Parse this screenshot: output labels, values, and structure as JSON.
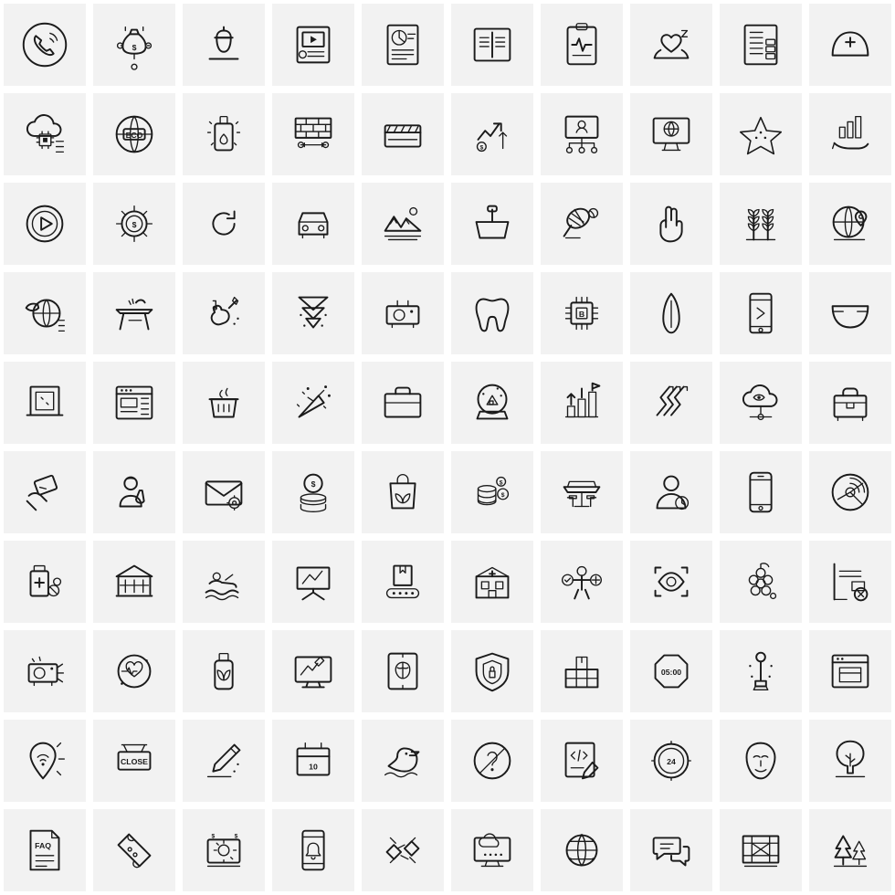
{
  "sheet": {
    "title": "Line Icon Sheet",
    "columns": 10,
    "rows": 10,
    "background_color": "#ffffff",
    "tile_color": "#f2f2f2",
    "stroke_color": "#1b1b1b"
  },
  "icons": [
    {
      "row": 1,
      "col": 1,
      "name": "call-phone-circle-icon",
      "label": "Phone Call"
    },
    {
      "row": 1,
      "col": 2,
      "name": "money-bag-connection-icon",
      "label": "Money Bag Network"
    },
    {
      "row": 1,
      "col": 3,
      "name": "acorn-nut-icon",
      "label": "Acorn"
    },
    {
      "row": 1,
      "col": 4,
      "name": "video-document-icon",
      "label": "Video Document"
    },
    {
      "row": 1,
      "col": 5,
      "name": "report-pie-chart-icon",
      "label": "Pie Chart Report"
    },
    {
      "row": 1,
      "col": 6,
      "name": "open-book-icon",
      "label": "Open Book"
    },
    {
      "row": 1,
      "col": 7,
      "name": "medical-clipboard-pulse-icon",
      "label": "Medical Report"
    },
    {
      "row": 1,
      "col": 8,
      "name": "heart-hands-icon",
      "label": "Heart in Hands"
    },
    {
      "row": 1,
      "col": 9,
      "name": "server-document-icon",
      "label": "Server Document"
    },
    {
      "row": 1,
      "col": 10,
      "name": "nurse-cap-icon",
      "label": "Nurse Cap"
    },
    {
      "row": 2,
      "col": 1,
      "name": "cloud-chip-icon",
      "label": "Cloud Computing Chip"
    },
    {
      "row": 2,
      "col": 2,
      "name": "eco-globe-icon",
      "label": "Eco Globe",
      "text": "ECO"
    },
    {
      "row": 2,
      "col": 3,
      "name": "perfume-bottle-icon",
      "label": "Perfume Bottle"
    },
    {
      "row": 2,
      "col": 4,
      "name": "brick-wall-icon",
      "label": "Brick Wall"
    },
    {
      "row": 2,
      "col": 5,
      "name": "clapperboard-icon",
      "label": "Clapperboard"
    },
    {
      "row": 2,
      "col": 6,
      "name": "growth-arrows-dollar-icon",
      "label": "Financial Growth"
    },
    {
      "row": 2,
      "col": 7,
      "name": "org-chart-user-icon",
      "label": "Organization Chart"
    },
    {
      "row": 2,
      "col": 8,
      "name": "global-network-monitor-icon",
      "label": "Global Network Monitor"
    },
    {
      "row": 2,
      "col": 9,
      "name": "starfish-icon",
      "label": "Starfish"
    },
    {
      "row": 2,
      "col": 10,
      "name": "bar-chart-hand-icon",
      "label": "Growth in Hand"
    },
    {
      "row": 3,
      "col": 1,
      "name": "play-button-circle-icon",
      "label": "Play Button"
    },
    {
      "row": 3,
      "col": 2,
      "name": "dollar-coin-target-icon",
      "label": "Dollar Coin"
    },
    {
      "row": 3,
      "col": 3,
      "name": "refresh-arrow-icon",
      "label": "Refresh"
    },
    {
      "row": 3,
      "col": 4,
      "name": "car-front-icon",
      "label": "Car"
    },
    {
      "row": 3,
      "col": 5,
      "name": "mountain-landscape-icon",
      "label": "Mountain Landscape"
    },
    {
      "row": 3,
      "col": 6,
      "name": "shopping-basket-icon",
      "label": "Shopping Basket"
    },
    {
      "row": 3,
      "col": 7,
      "name": "tennis-racket-ball-icon",
      "label": "Tennis Racket"
    },
    {
      "row": 3,
      "col": 8,
      "name": "victory-hand-icon",
      "label": "Victory Hand"
    },
    {
      "row": 3,
      "col": 9,
      "name": "wheat-plants-icon",
      "label": "Wheat Plants"
    },
    {
      "row": 3,
      "col": 10,
      "name": "global-location-pin-icon",
      "label": "Global Location"
    },
    {
      "row": 4,
      "col": 1,
      "name": "eco-globe-leaf-icon",
      "label": "Green Globe"
    },
    {
      "row": 4,
      "col": 2,
      "name": "ironing-board-icon",
      "label": "Ironing Board"
    },
    {
      "row": 4,
      "col": 3,
      "name": "violin-music-icon",
      "label": "Violin Music"
    },
    {
      "row": 4,
      "col": 4,
      "name": "down-arrows-icon",
      "label": "Download Arrows"
    },
    {
      "row": 4,
      "col": 5,
      "name": "projector-icon",
      "label": "Projector"
    },
    {
      "row": 4,
      "col": 6,
      "name": "tooth-icon",
      "label": "Tooth"
    },
    {
      "row": 4,
      "col": 7,
      "name": "processor-chip-icon",
      "label": "Processor Chip",
      "text": "B"
    },
    {
      "row": 4,
      "col": 8,
      "name": "surfboard-icon",
      "label": "Surfboard"
    },
    {
      "row": 4,
      "col": 9,
      "name": "smartphone-icon",
      "label": "Smartphone"
    },
    {
      "row": 4,
      "col": 10,
      "name": "diaper-icon",
      "label": "Diaper"
    },
    {
      "row": 5,
      "col": 1,
      "name": "window-frame-icon",
      "label": "Window"
    },
    {
      "row": 5,
      "col": 2,
      "name": "web-layout-icon",
      "label": "Web Layout"
    },
    {
      "row": 5,
      "col": 3,
      "name": "garbage-bin-icon",
      "label": "Trash Bin"
    },
    {
      "row": 5,
      "col": 4,
      "name": "party-popper-icon",
      "label": "Party Popper"
    },
    {
      "row": 5,
      "col": 5,
      "name": "briefcase-icon",
      "label": "Briefcase"
    },
    {
      "row": 5,
      "col": 6,
      "name": "snow-globe-icon",
      "label": "Snow Globe"
    },
    {
      "row": 5,
      "col": 7,
      "name": "growth-stairs-flag-icon",
      "label": "Growth Stairs"
    },
    {
      "row": 5,
      "col": 8,
      "name": "zigzag-arrows-icon",
      "label": "Zigzag Arrows"
    },
    {
      "row": 5,
      "col": 9,
      "name": "cloud-eye-monitoring-icon",
      "label": "Cloud Monitoring"
    },
    {
      "row": 5,
      "col": 10,
      "name": "business-bag-icon",
      "label": "Business Bag"
    },
    {
      "row": 6,
      "col": 1,
      "name": "hand-card-icon",
      "label": "Hand with Card"
    },
    {
      "row": 6,
      "col": 2,
      "name": "scientist-flask-icon",
      "label": "Scientist"
    },
    {
      "row": 6,
      "col": 3,
      "name": "email-settings-icon",
      "label": "Email Settings"
    },
    {
      "row": 6,
      "col": 4,
      "name": "dollar-coins-stack-icon",
      "label": "Coin Stack"
    },
    {
      "row": 6,
      "col": 5,
      "name": "eco-bag-icon",
      "label": "Eco Bag"
    },
    {
      "row": 6,
      "col": 6,
      "name": "money-coins-icon",
      "label": "Money Coins"
    },
    {
      "row": 6,
      "col": 7,
      "name": "outdoor-cafe-icon",
      "label": "Outdoor Cafe"
    },
    {
      "row": 6,
      "col": 8,
      "name": "user-time-icon",
      "label": "User Time"
    },
    {
      "row": 6,
      "col": 9,
      "name": "mobile-phone-icon",
      "label": "Mobile Phone"
    },
    {
      "row": 6,
      "col": 10,
      "name": "analytics-donut-icon",
      "label": "Analytics Donut"
    },
    {
      "row": 7,
      "col": 1,
      "name": "medicine-bottle-pills-icon",
      "label": "Medicine"
    },
    {
      "row": 7,
      "col": 2,
      "name": "bank-building-icon",
      "label": "Bank Building"
    },
    {
      "row": 7,
      "col": 3,
      "name": "swimmer-icon",
      "label": "Swimmer"
    },
    {
      "row": 7,
      "col": 4,
      "name": "presentation-board-icon",
      "label": "Presentation Board"
    },
    {
      "row": 7,
      "col": 5,
      "name": "conveyor-parcel-icon",
      "label": "Conveyor Parcel"
    },
    {
      "row": 7,
      "col": 6,
      "name": "hospital-building-icon",
      "label": "Hospital"
    },
    {
      "row": 7,
      "col": 7,
      "name": "person-choice-icon",
      "label": "Decision Making"
    },
    {
      "row": 7,
      "col": 8,
      "name": "eye-scan-icon",
      "label": "Eye Scan"
    },
    {
      "row": 7,
      "col": 9,
      "name": "grapes-icon",
      "label": "Grapes"
    },
    {
      "row": 7,
      "col": 10,
      "name": "remove-file-icon",
      "label": "Delete Item"
    },
    {
      "row": 8,
      "col": 1,
      "name": "camera-projector-icon",
      "label": "Camera Projector"
    },
    {
      "row": 8,
      "col": 2,
      "name": "heart-care-circle-icon",
      "label": "Heart Care"
    },
    {
      "row": 8,
      "col": 3,
      "name": "eco-bottle-icon",
      "label": "Eco Bottle"
    },
    {
      "row": 8,
      "col": 4,
      "name": "design-monitor-icon",
      "label": "Design Monitor"
    },
    {
      "row": 8,
      "col": 5,
      "name": "brain-scan-icon",
      "label": "Brain Scan"
    },
    {
      "row": 8,
      "col": 6,
      "name": "security-shield-icon",
      "label": "Security Shield"
    },
    {
      "row": 8,
      "col": 7,
      "name": "warehouse-boxes-icon",
      "label": "Warehouse Boxes"
    },
    {
      "row": 8,
      "col": 8,
      "name": "stop-timer-icon",
      "label": "Stop Timer",
      "text": "05:00"
    },
    {
      "row": 8,
      "col": 9,
      "name": "street-lamp-icon",
      "label": "Street Lamp"
    },
    {
      "row": 8,
      "col": 10,
      "name": "browser-window-icon",
      "label": "Browser Window"
    },
    {
      "row": 9,
      "col": 1,
      "name": "wifi-location-pin-icon",
      "label": "WiFi Location"
    },
    {
      "row": 9,
      "col": 2,
      "name": "close-sign-icon",
      "label": "Close Sign",
      "text": "CLOSE"
    },
    {
      "row": 9,
      "col": 3,
      "name": "pencil-edit-icon",
      "label": "Pencil"
    },
    {
      "row": 9,
      "col": 4,
      "name": "calendar-date-icon",
      "label": "Calendar",
      "text": "10"
    },
    {
      "row": 9,
      "col": 5,
      "name": "duck-icon",
      "label": "Duck"
    },
    {
      "row": 9,
      "col": 6,
      "name": "question-mark-circle-icon",
      "label": "Question Mark"
    },
    {
      "row": 9,
      "col": 7,
      "name": "code-document-edit-icon",
      "label": "Code Document"
    },
    {
      "row": 9,
      "col": 8,
      "name": "24-hours-clock-icon",
      "label": "24 Hours",
      "text": "24"
    },
    {
      "row": 9,
      "col": 9,
      "name": "mask-icon",
      "label": "Mask"
    },
    {
      "row": 9,
      "col": 10,
      "name": "tree-icon",
      "label": "Tree"
    },
    {
      "row": 10,
      "col": 1,
      "name": "faq-document-icon",
      "label": "FAQ Document",
      "text": "FAQ"
    },
    {
      "row": 10,
      "col": 2,
      "name": "ticket-icon",
      "label": "Ticket"
    },
    {
      "row": 10,
      "col": 3,
      "name": "business-settings-tablet-icon",
      "label": "Business Settings"
    },
    {
      "row": 10,
      "col": 4,
      "name": "mobile-notification-icon",
      "label": "Mobile Notification"
    },
    {
      "row": 10,
      "col": 5,
      "name": "satellite-icon",
      "label": "Satellite"
    },
    {
      "row": 10,
      "col": 6,
      "name": "cloud-monitor-icon",
      "label": "Cloud Monitor"
    },
    {
      "row": 10,
      "col": 7,
      "name": "global-network-icon",
      "label": "Global Network"
    },
    {
      "row": 10,
      "col": 8,
      "name": "chat-bubbles-icon",
      "label": "Chat Bubbles"
    },
    {
      "row": 10,
      "col": 9,
      "name": "blueprint-icon",
      "label": "Blueprint"
    },
    {
      "row": 10,
      "col": 10,
      "name": "pine-trees-icon",
      "label": "Pine Trees"
    }
  ]
}
